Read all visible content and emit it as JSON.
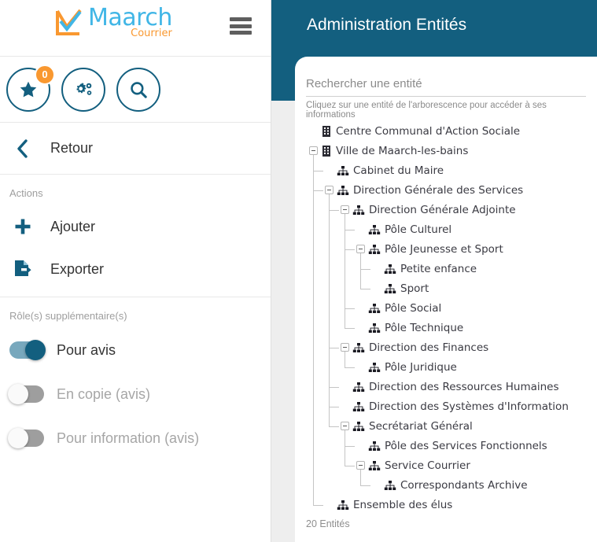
{
  "brand": {
    "name": "Maarch",
    "product": "Courrier",
    "logo_icon": "maarch-check-logo",
    "blue": "#41b6e6",
    "orange": "#f99830"
  },
  "topbar": {
    "menu_icon": "hamburger-menu-icon"
  },
  "quick_actions": [
    {
      "name": "favorites",
      "icon": "star-icon",
      "badge": "0"
    },
    {
      "name": "administration",
      "icon": "gears-icon",
      "badge": null
    },
    {
      "name": "search",
      "icon": "magnifier-icon",
      "badge": null
    }
  ],
  "sidebar": {
    "back_label": "Retour",
    "back_icon": "chevron-left-icon",
    "actions_title": "Actions",
    "actions": [
      {
        "label": "Ajouter",
        "icon": "plus-icon"
      },
      {
        "label": "Exporter",
        "icon": "export-file-icon"
      }
    ],
    "roles_title": "Rôle(s) supplémentaire(s)",
    "roles": [
      {
        "label": "Pour avis",
        "on": true
      },
      {
        "label": "En copie (avis)",
        "on": false
      },
      {
        "label": "Pour information (avis)",
        "on": false
      }
    ]
  },
  "header": {
    "title": "Administration Entités",
    "background": "#135f7f"
  },
  "search": {
    "placeholder": "Rechercher une entité",
    "value": "",
    "hint": "Cliquez sur une entité de l'arborescence pour accéder à ses informations"
  },
  "tree": {
    "nodes": [
      {
        "label": "Centre Communal d'Action Sociale",
        "depth": 1,
        "icon": "building-icon",
        "toggle": "none"
      },
      {
        "label": "Ville de Maarch-les-bains",
        "depth": 1,
        "icon": "building-icon",
        "toggle": "minus"
      },
      {
        "label": "Cabinet du Maire",
        "depth": 2,
        "icon": "org-chart-icon",
        "toggle": "none"
      },
      {
        "label": "Direction Générale des Services",
        "depth": 2,
        "icon": "org-chart-icon",
        "toggle": "minus"
      },
      {
        "label": "Direction Générale Adjointe",
        "depth": 3,
        "icon": "org-chart-icon",
        "toggle": "minus"
      },
      {
        "label": "Pôle Culturel",
        "depth": 4,
        "icon": "org-chart-icon",
        "toggle": "none"
      },
      {
        "label": "Pôle Jeunesse et Sport",
        "depth": 4,
        "icon": "org-chart-icon",
        "toggle": "minus"
      },
      {
        "label": "Petite enfance",
        "depth": 5,
        "icon": "org-chart-icon",
        "toggle": "none"
      },
      {
        "label": "Sport",
        "depth": 5,
        "icon": "org-chart-icon",
        "toggle": "none"
      },
      {
        "label": "Pôle Social",
        "depth": 4,
        "icon": "org-chart-icon",
        "toggle": "none"
      },
      {
        "label": "Pôle Technique",
        "depth": 4,
        "icon": "org-chart-icon",
        "toggle": "none"
      },
      {
        "label": "Direction des Finances",
        "depth": 3,
        "icon": "org-chart-icon",
        "toggle": "minus"
      },
      {
        "label": "Pôle Juridique",
        "depth": 4,
        "icon": "org-chart-icon",
        "toggle": "none"
      },
      {
        "label": "Direction des Ressources Humaines",
        "depth": 3,
        "icon": "org-chart-icon",
        "toggle": "none"
      },
      {
        "label": "Direction des Systèmes d'Information",
        "depth": 3,
        "icon": "org-chart-icon",
        "toggle": "none"
      },
      {
        "label": "Secrétariat Général",
        "depth": 3,
        "icon": "org-chart-icon",
        "toggle": "minus"
      },
      {
        "label": "Pôle des Services Fonctionnels",
        "depth": 4,
        "icon": "org-chart-icon",
        "toggle": "none"
      },
      {
        "label": "Service Courrier",
        "depth": 4,
        "icon": "org-chart-icon",
        "toggle": "minus"
      },
      {
        "label": "Correspondants Archive",
        "depth": 5,
        "icon": "org-chart-icon",
        "toggle": "none"
      },
      {
        "label": "Ensemble des élus",
        "depth": 2,
        "icon": "org-chart-icon",
        "toggle": "none"
      }
    ],
    "count_label": "20 Entités"
  }
}
